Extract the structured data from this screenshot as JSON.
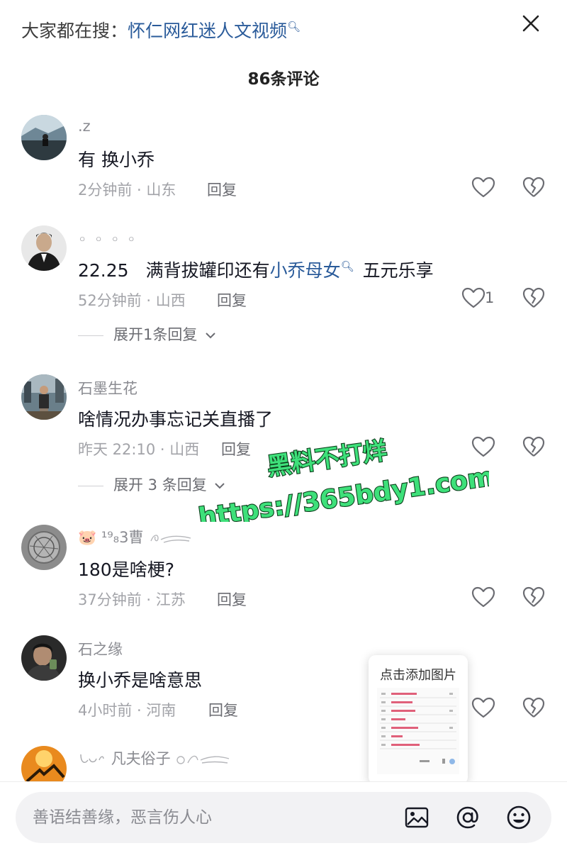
{
  "header": {
    "search_prefix": "大家都在搜：",
    "search_term": "怀仁网红迷人文视频",
    "comment_count": "86条评论"
  },
  "comments": [
    {
      "username": ".z",
      "content": "有  换小乔",
      "time_loc": "2分钟前 · 山东",
      "reply": "回复"
    },
    {
      "username": "◦ ◦ ◦ ◦",
      "content_a": "22.25",
      "content_b": "满背拔罐印还有",
      "content_link": "小乔母女",
      "content_c": "五元乐享",
      "time_loc": "52分钟前 · 山西",
      "reply": "回复",
      "likes": "1",
      "expand": "展开1条回复"
    },
    {
      "username": "石墨生花",
      "content": "啥情况办事忘记关直播了",
      "time_loc": "昨天 22:10 · 山西",
      "reply": "回复",
      "expand": "展开 3 条回复"
    },
    {
      "username_emoji": "🐷",
      "username": "¹⁹₈3曹",
      "content": "180是啥梗?",
      "time_loc": "37分钟前 · 江苏",
      "reply": "回复"
    },
    {
      "username": "石之缘",
      "content": "换小乔是啥意思",
      "time_loc": "4小时前 · 河南",
      "reply": "回复"
    },
    {
      "username": "凡夫俗子"
    }
  ],
  "watermark": {
    "line1": "黑料不打烊",
    "line2": "https://365bdy1.com"
  },
  "popup": {
    "title": "点击添加图片"
  },
  "input": {
    "placeholder": "善语结善缘，恶言伤人心"
  },
  "icons": {
    "close": "close-icon",
    "search": "search-icon",
    "heart": "heart-icon",
    "dislike": "broken-heart-icon",
    "image": "image-icon",
    "mention": "at-icon",
    "emoji": "emoji-icon"
  },
  "colors": {
    "link": "#2a5b9a",
    "watermark_fill": "#3ee07a",
    "watermark_stroke": "#0b3d1a"
  }
}
